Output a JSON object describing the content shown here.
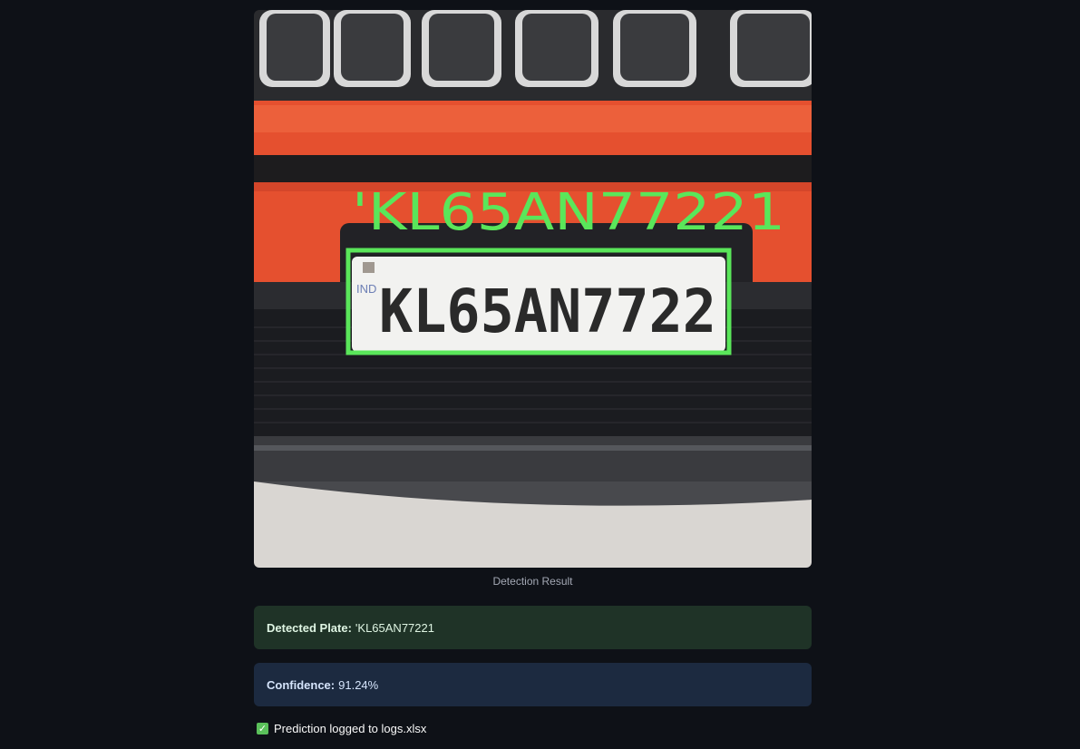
{
  "result": {
    "overlay_text": "'KL65AN77221",
    "plate_text": "KL65AN7722",
    "plate_country": "IND",
    "caption": "Detection Result",
    "image_alt": "Detection Result"
  },
  "detected": {
    "label": "Detected Plate:",
    "value": "'KL65AN77221"
  },
  "confidence": {
    "label": "Confidence:",
    "value": "91.24%"
  },
  "log": {
    "icon": "check-icon",
    "text": "Prediction logged to logs.xlsx"
  },
  "colors": {
    "background": "#0e1117",
    "success_bg": "#1f3327",
    "info_bg": "#1c2a40",
    "detection_green": "#5ae65a",
    "car_body": "#e5502f"
  }
}
